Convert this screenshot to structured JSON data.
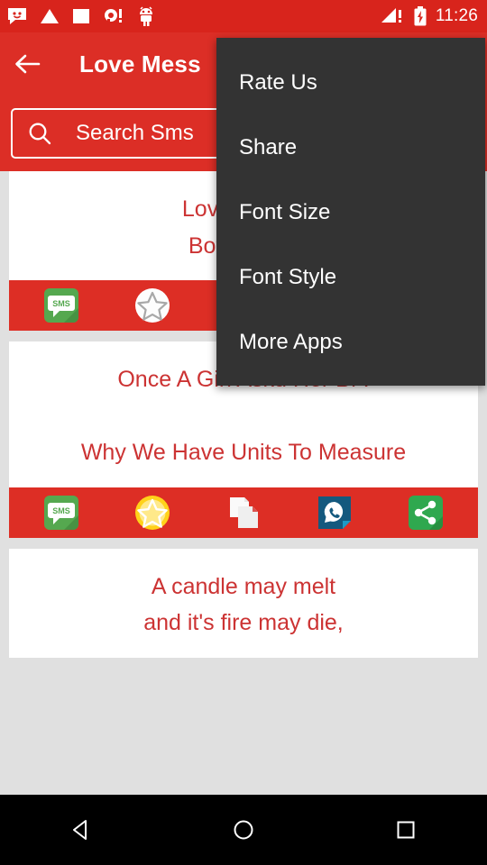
{
  "status_bar": {
    "time": "11:26",
    "left_icons": [
      "message-icon",
      "triangle-icon",
      "square-icon",
      "alert-dot-icon",
      "android-robot-icon"
    ],
    "right_icons": [
      "signal-alert-icon",
      "battery-charging-icon"
    ],
    "background": "#d8241c"
  },
  "toolbar": {
    "back_icon": "back-arrow-icon",
    "title": "Love Mess",
    "background": "#dc2e26"
  },
  "search": {
    "icon": "search-icon",
    "placeholder": "Search Sms",
    "value": ""
  },
  "menu": {
    "visible": true,
    "background": "#333333",
    "items": [
      {
        "label": "Rate Us"
      },
      {
        "label": "Share"
      },
      {
        "label": "Font Size"
      },
      {
        "label": "Font Style"
      },
      {
        "label": "More Apps"
      }
    ]
  },
  "cards": [
    {
      "lines": [
        "Love & Rain",
        "Both Gives"
      ],
      "text_color": "#cc3333",
      "actions": [
        {
          "name": "sms-icon",
          "label": "SMS"
        },
        {
          "name": "favorite-star-icon",
          "state": "off"
        },
        {
          "name": "copy-icon"
        },
        {
          "name": "whatsapp-icon"
        },
        {
          "name": "share-icon"
        }
      ]
    },
    {
      "lines": [
        "Once A Girl Askd Her Bf :",
        "",
        "Why We Have Units To Measure"
      ],
      "text_color": "#cc3333",
      "actions": [
        {
          "name": "sms-icon",
          "label": "SMS"
        },
        {
          "name": "favorite-star-icon",
          "state": "on"
        },
        {
          "name": "copy-icon"
        },
        {
          "name": "whatsapp-icon"
        },
        {
          "name": "share-icon"
        }
      ]
    },
    {
      "lines": [
        "A candle may melt",
        "and it's fire may die,"
      ],
      "text_color": "#cc3333",
      "actions": []
    }
  ],
  "nav_bar": {
    "back": "nav-back-icon",
    "home": "nav-home-icon",
    "recents": "nav-recents-icon",
    "background": "#000000"
  },
  "colors": {
    "primary_red": "#dc2e26",
    "status_red": "#d8241c",
    "accent_text": "#cc3333",
    "page_background": "#e0e0e0",
    "menu_background": "#333333"
  }
}
